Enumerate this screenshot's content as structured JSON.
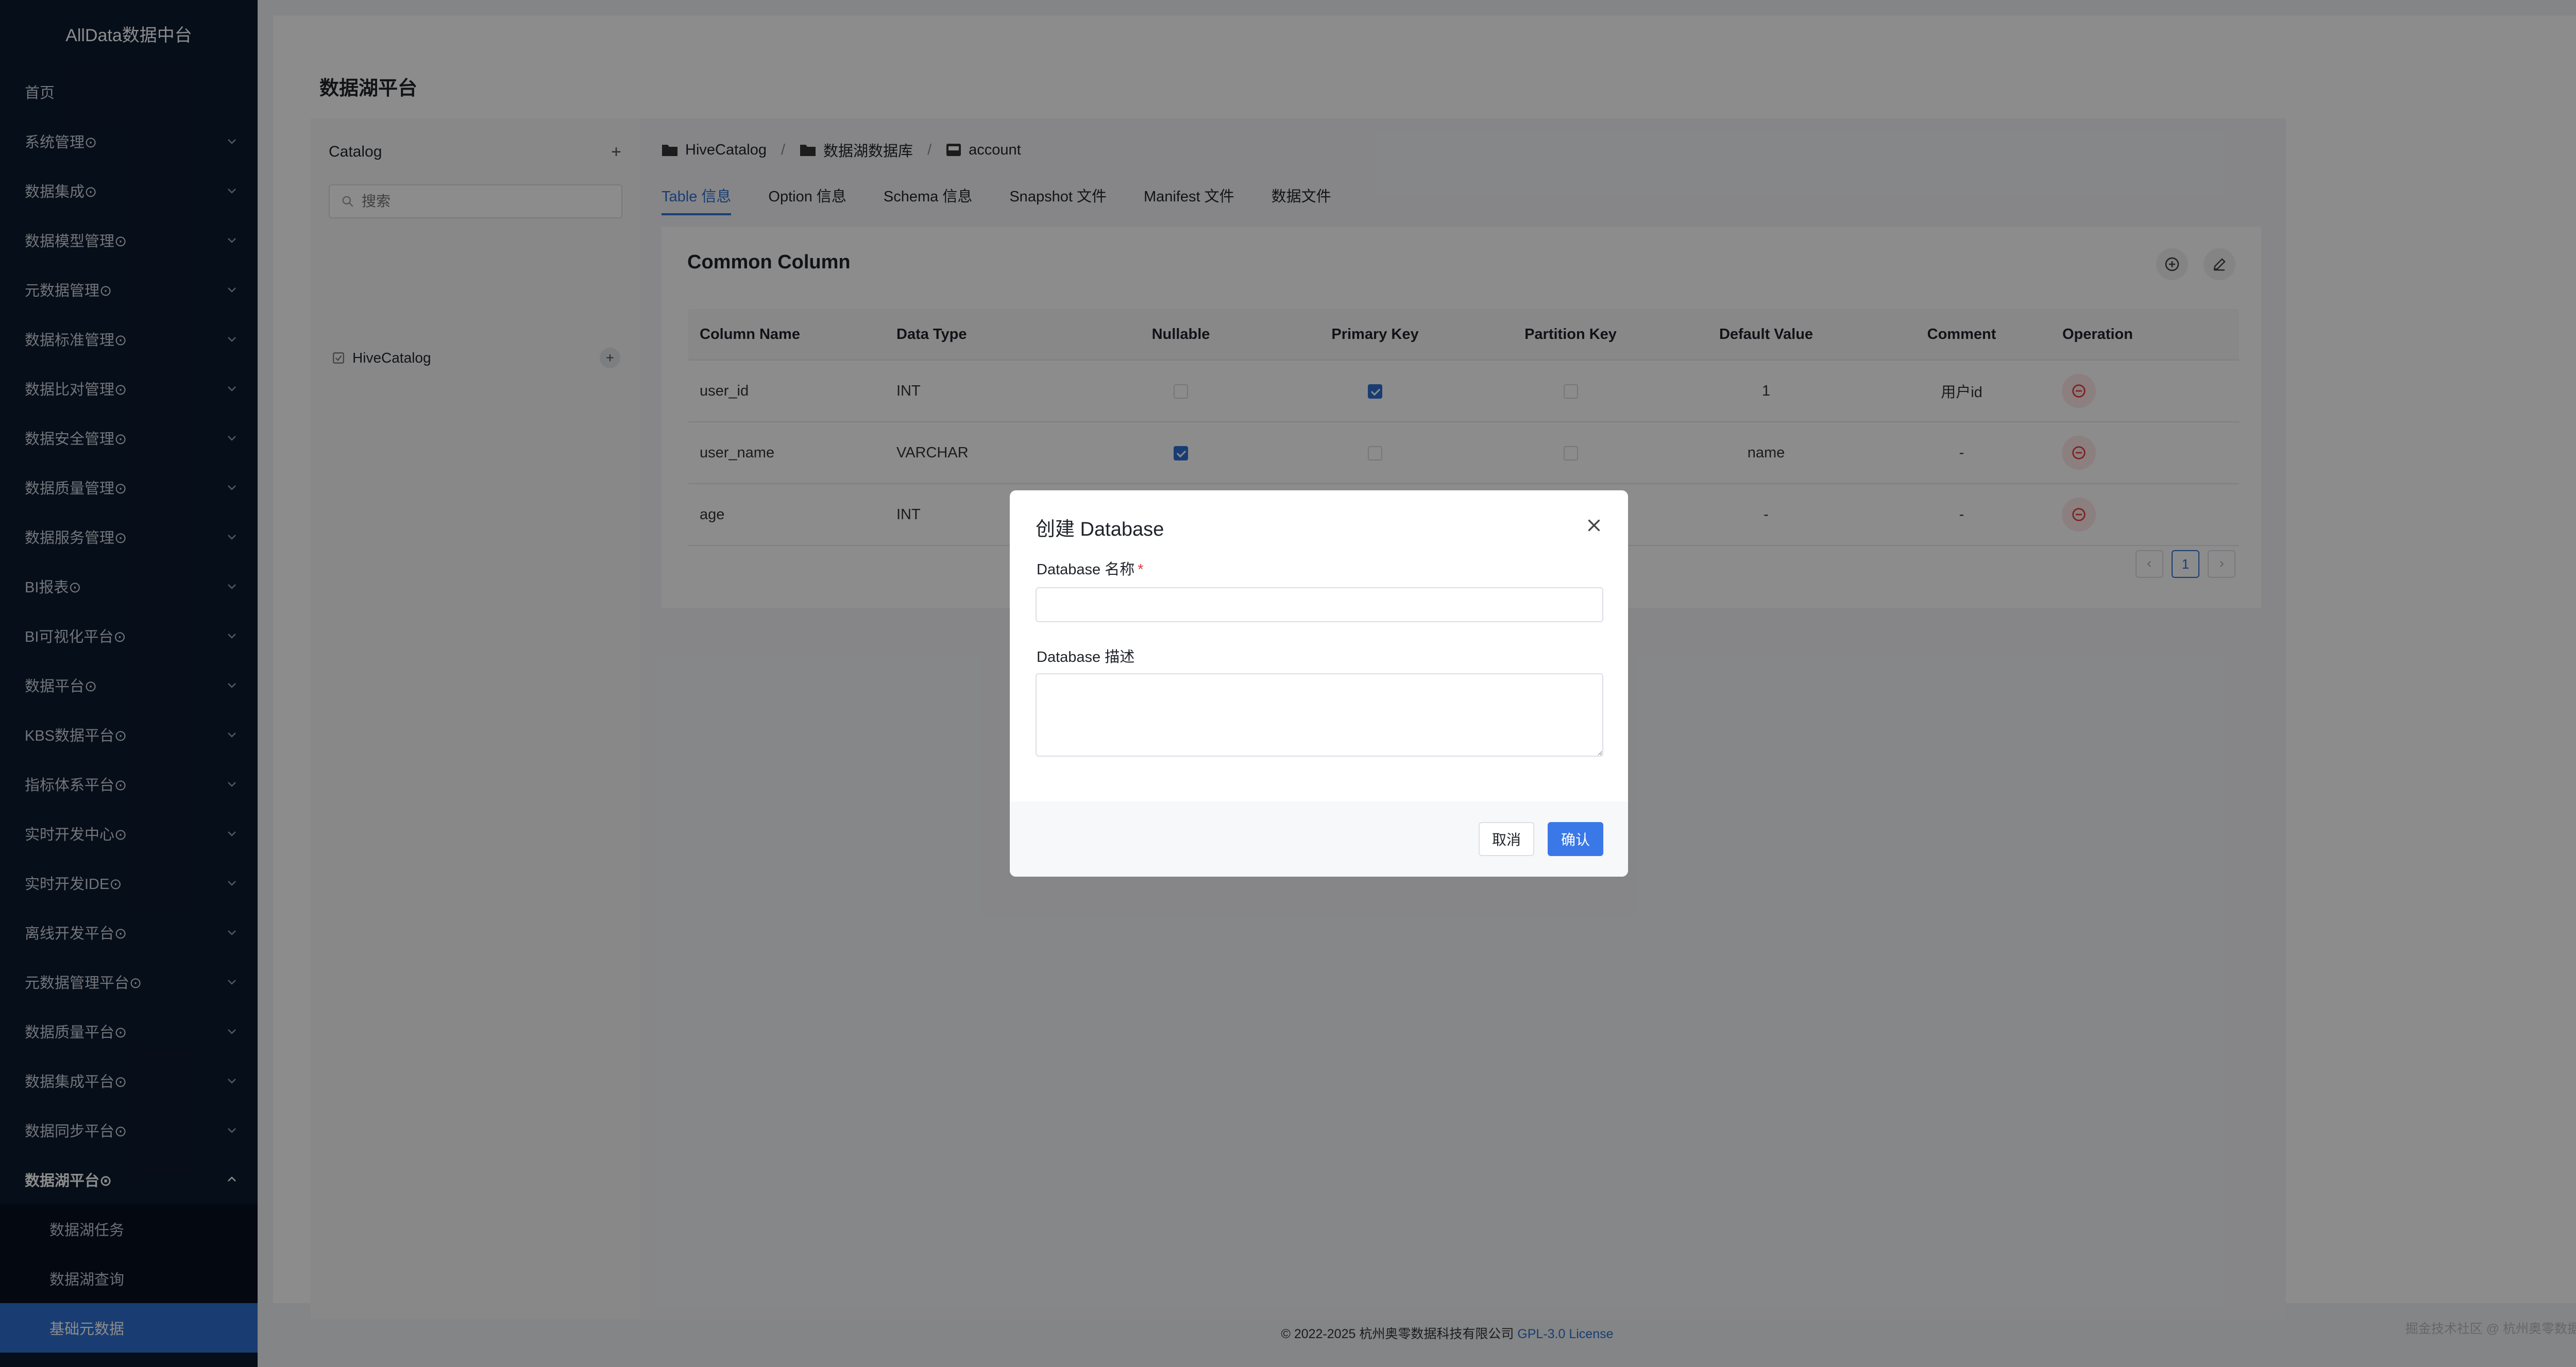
{
  "sidebar": {
    "brand": "AllData数据中台",
    "items": [
      {
        "label": "首页",
        "expandable": false
      },
      {
        "label": "系统管理⊙",
        "expandable": true
      },
      {
        "label": "数据集成⊙",
        "expandable": true
      },
      {
        "label": "数据模型管理⊙",
        "expandable": true
      },
      {
        "label": "元数据管理⊙",
        "expandable": true
      },
      {
        "label": "数据标准管理⊙",
        "expandable": true
      },
      {
        "label": "数据比对管理⊙",
        "expandable": true
      },
      {
        "label": "数据安全管理⊙",
        "expandable": true
      },
      {
        "label": "数据质量管理⊙",
        "expandable": true
      },
      {
        "label": "数据服务管理⊙",
        "expandable": true
      },
      {
        "label": "BI报表⊙",
        "expandable": true
      },
      {
        "label": "BI可视化平台⊙",
        "expandable": true
      },
      {
        "label": "数据平台⊙",
        "expandable": true
      },
      {
        "label": "KBS数据平台⊙",
        "expandable": true
      },
      {
        "label": "指标体系平台⊙",
        "expandable": true
      },
      {
        "label": "实时开发中心⊙",
        "expandable": true
      },
      {
        "label": "实时开发IDE⊙",
        "expandable": true
      },
      {
        "label": "离线开发平台⊙",
        "expandable": true
      },
      {
        "label": "元数据管理平台⊙",
        "expandable": true
      },
      {
        "label": "数据质量平台⊙",
        "expandable": true
      },
      {
        "label": "数据集成平台⊙",
        "expandable": true
      },
      {
        "label": "数据同步平台⊙",
        "expandable": true
      }
    ],
    "open_item": {
      "label": "数据湖平台⊙"
    },
    "submenu": [
      {
        "label": "数据湖任务"
      },
      {
        "label": "数据湖查询"
      },
      {
        "label": "基础元数据"
      }
    ],
    "active_submenu": "基础元数据"
  },
  "page": {
    "title": "数据湖平台"
  },
  "catalog": {
    "header": "Catalog",
    "add_symbol": "+",
    "search_placeholder": "搜索",
    "tree": [
      {
        "label": "HiveCatalog"
      }
    ]
  },
  "breadcrumb": [
    {
      "label": "HiveCatalog",
      "icon": "folder-icon"
    },
    {
      "label": "数据湖数据库",
      "icon": "folder-icon"
    },
    {
      "label": "account",
      "icon": "table-icon"
    }
  ],
  "breadcrumb_sep": "/",
  "tabs": [
    {
      "label": "Table 信息",
      "active": true
    },
    {
      "label": "Option 信息",
      "active": false
    },
    {
      "label": "Schema 信息",
      "active": false
    },
    {
      "label": "Snapshot 文件",
      "active": false
    },
    {
      "label": "Manifest 文件",
      "active": false
    },
    {
      "label": "数据文件",
      "active": false
    }
  ],
  "columns_card": {
    "title": "Common Column",
    "headers": [
      "Column Name",
      "Data Type",
      "Nullable",
      "Primary Key",
      "Partition Key",
      "Default Value",
      "Comment",
      "Operation"
    ],
    "rows": [
      {
        "name": "user_id",
        "type": "INT",
        "nullable": false,
        "primary_key": true,
        "partition_key": false,
        "default": "1",
        "comment": "用户id"
      },
      {
        "name": "user_name",
        "type": "VARCHAR",
        "nullable": true,
        "primary_key": false,
        "partition_key": false,
        "default": "name",
        "comment": "-"
      },
      {
        "name": "age",
        "type": "INT",
        "nullable": false,
        "primary_key": true,
        "partition_key": true,
        "default": "-",
        "comment": "-"
      }
    ],
    "pagination": {
      "current": "1"
    }
  },
  "footer": {
    "text": "© 2022-2025 杭州奥零数据科技有限公司 ",
    "link": "GPL-3.0 License"
  },
  "watermark": "掘金技术社区 @ 杭州奥零数据科技",
  "modal": {
    "title": "创建 Database",
    "name_label": "Database 名称",
    "required_mark": "*",
    "name_value": "",
    "desc_label": "Database 描述",
    "desc_value": "",
    "cancel_label": "取消",
    "confirm_label": "确认"
  },
  "colors": {
    "sidebar_bg": "#0c1a2e",
    "accent": "#2f6fd0",
    "confirm_btn": "#3b78e7",
    "danger_bg": "#fde8e8",
    "danger": "#e4393c"
  }
}
